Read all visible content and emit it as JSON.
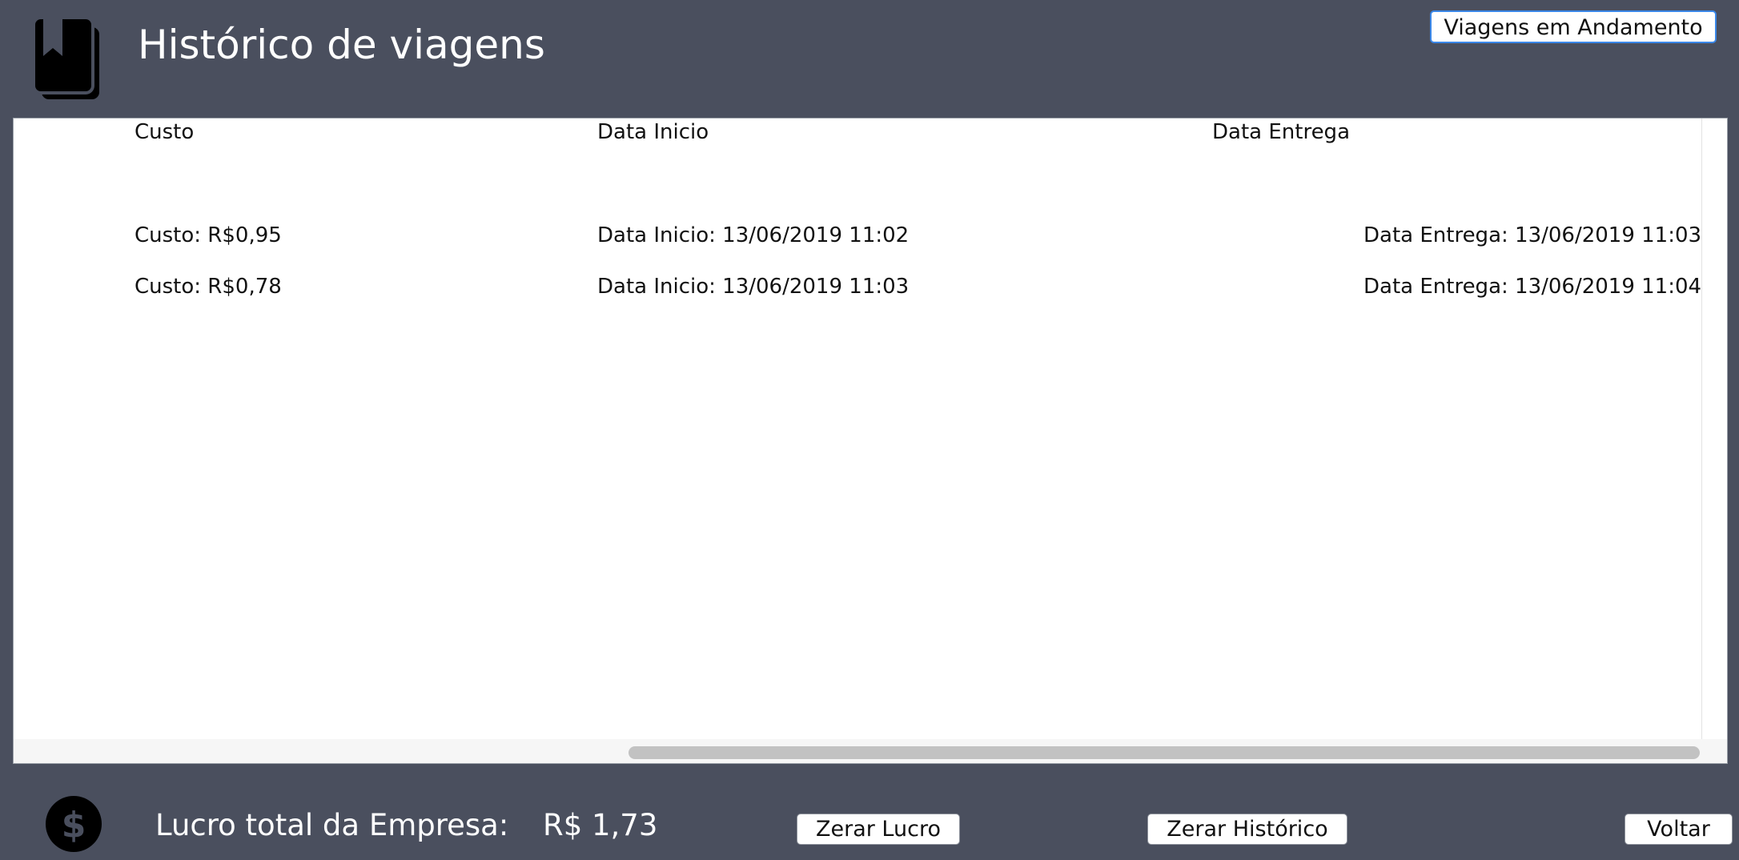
{
  "header": {
    "title": "Histórico de viagens",
    "icon": "book-icon",
    "in_progress_button": "Viagens em Andamento"
  },
  "history_list": {
    "columns": [
      "Custo",
      "Data Inicio",
      "Data Entrega"
    ],
    "rows": [
      {
        "custo": "Custo: R$0,95",
        "data_inicio": "Data Inicio: 13/06/2019  11:02",
        "data_entrega": "Data Entrega: 13/06/2019  11:03"
      },
      {
        "custo": "Custo: R$0,78",
        "data_inicio": "Data Inicio: 13/06/2019  11:03",
        "data_entrega": "Data Entrega: 13/06/2019  11:04"
      }
    ]
  },
  "footer": {
    "icon": "dollar-icon",
    "profit_label": "Lucro total da Empresa:",
    "profit_value": "R$ 1,73",
    "reset_profit_button": "Zerar Lucro",
    "reset_history_button": "Zerar Histórico",
    "back_button": "Voltar"
  },
  "colors": {
    "background": "#4a4f5e",
    "panel": "#ffffff",
    "focus_ring": "#3a87e8"
  }
}
